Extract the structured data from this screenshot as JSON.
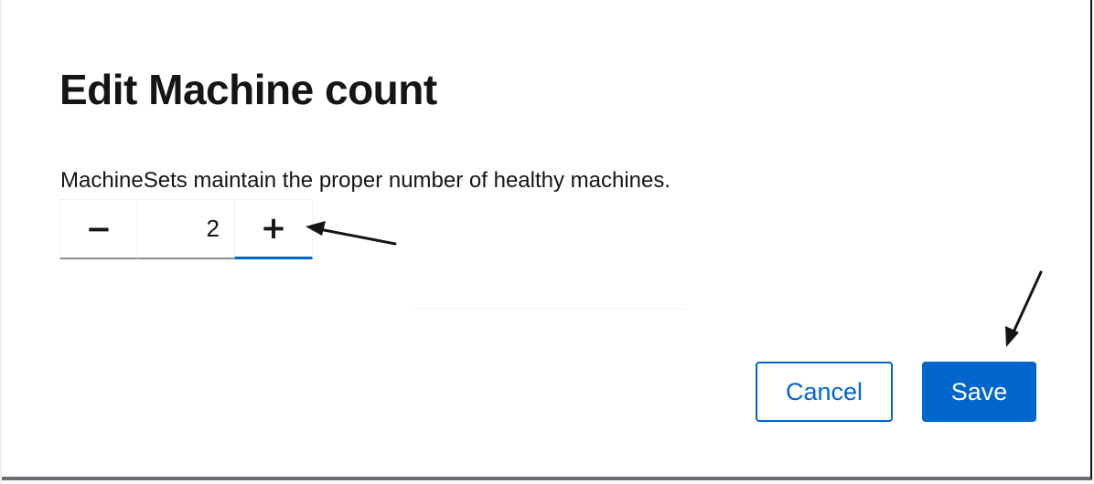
{
  "modal": {
    "title": "Edit Machine count",
    "description": "MachineSets maintain the proper number of healthy machines."
  },
  "stepper": {
    "minus_symbol": "−",
    "plus_symbol": "+",
    "value": "2"
  },
  "footer": {
    "cancel_label": "Cancel",
    "save_label": "Save"
  },
  "colors": {
    "primary": "#0066cc",
    "text": "#151515",
    "annotation_arrow": "#151515"
  }
}
